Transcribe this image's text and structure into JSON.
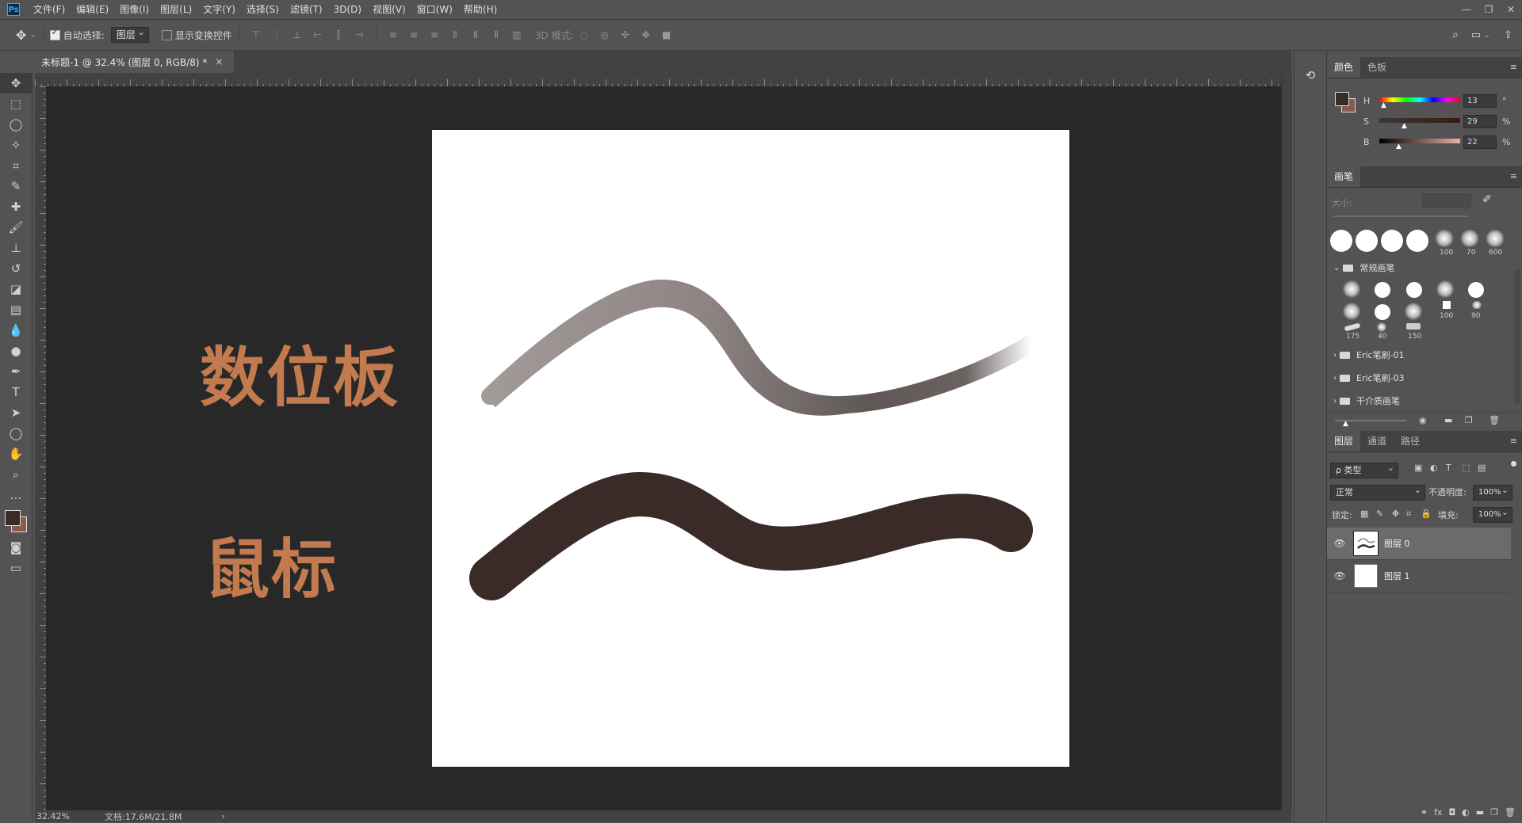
{
  "app": {
    "logo": "Ps"
  },
  "menu": [
    "文件(F)",
    "编辑(E)",
    "图像(I)",
    "图层(L)",
    "文字(Y)",
    "选择(S)",
    "滤镜(T)",
    "3D(D)",
    "视图(V)",
    "窗口(W)",
    "帮助(H)"
  ],
  "window_controls": {
    "minimize": "—",
    "restore": "❐",
    "close": "✕"
  },
  "options": {
    "auto_select_label": "自动选择:",
    "auto_select_value": "图层",
    "show_transform_label": "显示变换控件",
    "mode_3d_label": "3D 模式:"
  },
  "document_tab": {
    "title": "未标题-1 @ 32.4% (图层 0, RGB/8) *",
    "close": "×"
  },
  "canvas": {
    "label_tablet": "数位板",
    "label_mouse": "鼠标",
    "stroke_colors": {
      "tablet_start": "#a29a98",
      "tablet_mid": "#5f5756",
      "mouse": "#3b2b28"
    }
  },
  "status": {
    "zoom": "32.42%",
    "doc_size": "文档:17.6M/21.8M",
    "arrow": "›"
  },
  "color_panel": {
    "tabs": [
      "颜色",
      "色板"
    ],
    "h_label": "H",
    "h_value": "13",
    "h_unit": "°",
    "s_label": "S",
    "s_value": "29",
    "s_unit": "%",
    "b_label": "B",
    "b_value": "22",
    "b_unit": "%",
    "foreground": "#3b2b28",
    "background": "#8a5a4e"
  },
  "brush_panel": {
    "tab": "画笔",
    "size_label": "大小:",
    "preset_nums": [
      "100",
      "70",
      "600"
    ],
    "group_label": "常规画笔",
    "grid_nums": [
      "100",
      "90",
      "175",
      "40",
      "150"
    ],
    "folders": [
      "Eric笔刷-01",
      "Eric笔刷-03",
      "干介质画笔"
    ]
  },
  "layers_panel": {
    "tabs": [
      "图层",
      "通道",
      "路径"
    ],
    "filter_label": "ρ 类型",
    "blend_mode": "正常",
    "opacity_label": "不透明度:",
    "opacity_value": "100%",
    "lock_label": "锁定:",
    "fill_label": "填充:",
    "fill_value": "100%",
    "layers": [
      {
        "name": "图层 0",
        "selected": true
      },
      {
        "name": "图层 1",
        "selected": false
      }
    ]
  }
}
